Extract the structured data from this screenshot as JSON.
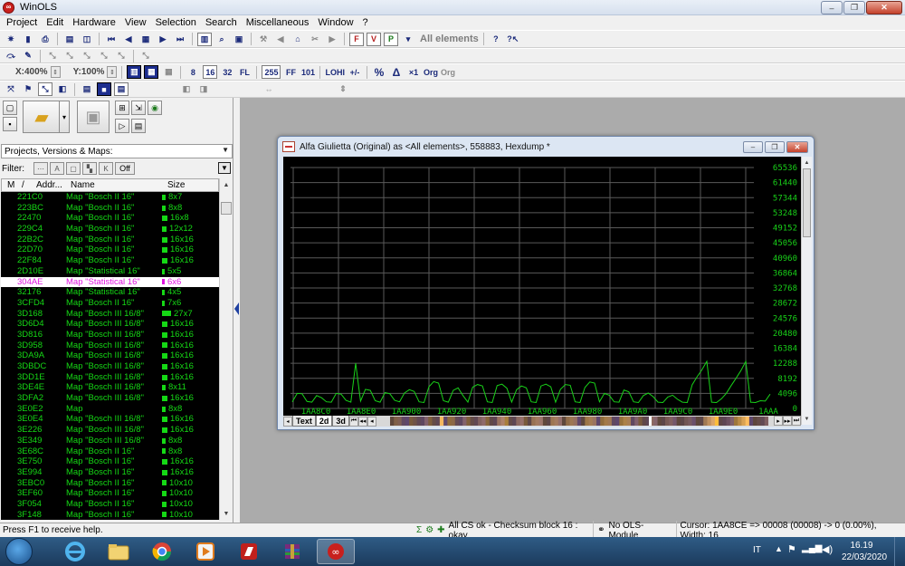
{
  "window": {
    "title": "WinOLS",
    "minimize": "–",
    "maximize": "❐",
    "close": "✕"
  },
  "menu": [
    "Project",
    "Edit",
    "Hardware",
    "View",
    "Selection",
    "Search",
    "Miscellaneous",
    "Window",
    "?"
  ],
  "toolbar": {
    "all_elements": "All elements",
    "zoom_x": "X:400%",
    "zoom_y": "Y:100%",
    "btn_8": "8",
    "btn_16": "16",
    "btn_32": "32",
    "btn_fl": "FL",
    "btn_255": "255",
    "btn_ff": "FF",
    "btn_101": "101",
    "btn_lohi": "LOHI",
    "btn_percent": "%",
    "btn_delta": "Δ",
    "btn_x1": "×1",
    "btn_org": "Org",
    "btn_orig": "Org",
    "btn_f": "F",
    "btn_v": "V",
    "btn_p": "P"
  },
  "left_panel": {
    "dropdown": "Projects, Versions & Maps:",
    "filter_label": "Filter:",
    "off_label": "Off",
    "columns": {
      "m": "M",
      "slash": "/",
      "addr": "Addr...",
      "name": "Name",
      "size": "Size"
    },
    "rows": [
      {
        "addr": "221C0",
        "name": "Map \"Bosch II 16\"",
        "size": "8x7",
        "w": 4
      },
      {
        "addr": "223BC",
        "name": "Map \"Bosch II 16\"",
        "size": "8x8",
        "w": 4
      },
      {
        "addr": "22470",
        "name": "Map \"Bosch II 16\"",
        "size": "16x8",
        "w": 6
      },
      {
        "addr": "229C4",
        "name": "Map \"Bosch II 16\"",
        "size": "12x12",
        "w": 5
      },
      {
        "addr": "22B2C",
        "name": "Map \"Bosch II 16\"",
        "size": "16x16",
        "w": 6
      },
      {
        "addr": "22D70",
        "name": "Map \"Bosch II 16\"",
        "size": "16x16",
        "w": 6
      },
      {
        "addr": "22F84",
        "name": "Map \"Bosch II 16\"",
        "size": "16x16",
        "w": 6
      },
      {
        "addr": "2D10E",
        "name": "Map \"Statistical 16\"",
        "size": "5x5",
        "w": 3
      },
      {
        "addr": "304AE",
        "name": "Map \"Statistical 16\"",
        "size": "6x6",
        "w": 3,
        "selected": true
      },
      {
        "addr": "32176",
        "name": "Map \"Statistical 16\"",
        "size": "4x5",
        "w": 3
      },
      {
        "addr": "3CFD4",
        "name": "Map \"Bosch II 16\"",
        "size": "7x6",
        "w": 3
      },
      {
        "addr": "3D168",
        "name": "Map \"Bosch III 16/8\"",
        "size": "27x7",
        "w": 10
      },
      {
        "addr": "3D6D4",
        "name": "Map \"Bosch III 16/8\"",
        "size": "16x16",
        "w": 6
      },
      {
        "addr": "3D816",
        "name": "Map \"Bosch III 16/8\"",
        "size": "16x16",
        "w": 6
      },
      {
        "addr": "3D958",
        "name": "Map \"Bosch III 16/8\"",
        "size": "16x16",
        "w": 6
      },
      {
        "addr": "3DA9A",
        "name": "Map \"Bosch III 16/8\"",
        "size": "16x16",
        "w": 6
      },
      {
        "addr": "3DBDC",
        "name": "Map \"Bosch III 16/8\"",
        "size": "16x16",
        "w": 6
      },
      {
        "addr": "3DD1E",
        "name": "Map \"Bosch III 16/8\"",
        "size": "16x16",
        "w": 6
      },
      {
        "addr": "3DE4E",
        "name": "Map \"Bosch III 16/8\"",
        "size": "8x11",
        "w": 4
      },
      {
        "addr": "3DFA2",
        "name": "Map \"Bosch III 16/8\"",
        "size": "16x16",
        "w": 6
      },
      {
        "addr": "3E0E2",
        "name": "Map",
        "size": "8x8",
        "w": 4
      },
      {
        "addr": "3E0E4",
        "name": "Map \"Bosch III 16/8\"",
        "size": "16x16",
        "w": 6
      },
      {
        "addr": "3E226",
        "name": "Map \"Bosch III 16/8\"",
        "size": "16x16",
        "w": 6
      },
      {
        "addr": "3E349",
        "name": "Map \"Bosch III 16/8\"",
        "size": "8x8",
        "w": 4
      },
      {
        "addr": "3E68C",
        "name": "Map \"Bosch II 16\"",
        "size": "8x8",
        "w": 4
      },
      {
        "addr": "3E750",
        "name": "Map \"Bosch II 16\"",
        "size": "16x16",
        "w": 6
      },
      {
        "addr": "3E994",
        "name": "Map \"Bosch II 16\"",
        "size": "16x16",
        "w": 6
      },
      {
        "addr": "3EBC0",
        "name": "Map \"Bosch II 16\"",
        "size": "10x10",
        "w": 5
      },
      {
        "addr": "3EF60",
        "name": "Map \"Bosch II 16\"",
        "size": "10x10",
        "w": 5
      },
      {
        "addr": "3F054",
        "name": "Map \"Bosch II 16\"",
        "size": "10x10",
        "w": 5
      },
      {
        "addr": "3F148",
        "name": "Map \"Bosch II 16\"",
        "size": "10x10",
        "w": 5
      }
    ]
  },
  "child_window": {
    "title": "Alfa Giulietta (Original) as <All elements>, 558883, Hexdump *",
    "tabs": [
      "Text",
      "2d",
      "3d"
    ],
    "active_tab": "2d"
  },
  "chart_data": {
    "type": "line",
    "y_ticks": [
      65536,
      61440,
      57344,
      53248,
      49152,
      45056,
      40960,
      36864,
      32768,
      28672,
      24576,
      20480,
      16384,
      12288,
      8192,
      4096,
      0
    ],
    "x_ticks": [
      "1AA8C0",
      "1AA8E0",
      "1AA900",
      "1AA920",
      "1AA940",
      "1AA960",
      "1AA980",
      "1AA9A0",
      "1AA9C0",
      "1AA9E0",
      "1AAA"
    ],
    "ylim": [
      0,
      65536
    ],
    "grid": true,
    "line_color": "#19d119",
    "series": [
      {
        "values": [
          1800,
          4100,
          4000,
          1900,
          1700,
          3500,
          2900,
          1800,
          1700,
          4100,
          3900,
          2200,
          1700,
          12300,
          2000,
          5200,
          4900,
          2100,
          1700,
          4300,
          4000,
          2200,
          1800,
          4200,
          5100,
          4600,
          1800,
          1600,
          5900,
          7300,
          6900,
          2100,
          1700,
          4900,
          5600,
          3500,
          1700,
          5800,
          6500,
          6100,
          1800,
          1600,
          6200,
          6600,
          5500,
          1700,
          5100,
          6100,
          5600,
          1800,
          1600,
          6100,
          6600,
          5900,
          1700,
          5200,
          6500,
          6300,
          1800,
          1600,
          5700,
          7200,
          6900,
          1800,
          4100,
          3600,
          1800,
          1700,
          5000,
          4500,
          1800,
          1600,
          3500,
          4200,
          3200,
          1700,
          1600,
          3100,
          3600,
          2500,
          1700,
          1600,
          6400,
          8600,
          10500,
          12800,
          1700,
          1600,
          2600,
          4100,
          6200,
          8200,
          10300,
          12800,
          1700,
          1600,
          2100,
          2000,
          3900
        ]
      }
    ]
  },
  "status": {
    "help": "Press F1 to receive help.",
    "checksum": "All CS ok - Checksum block 16 : okay",
    "module": "No OLS-Module",
    "cursor": "Cursor: 1AA8CE => 00008 (00008) -> 0 (0.00%), Width: 16"
  },
  "taskbar": {
    "lang": "IT",
    "time": "16.19",
    "date": "22/03/2020"
  },
  "colors": {
    "list_green": "#15d815",
    "selected_magenta": "#e015e0",
    "mdi_bg": "#ababab"
  }
}
